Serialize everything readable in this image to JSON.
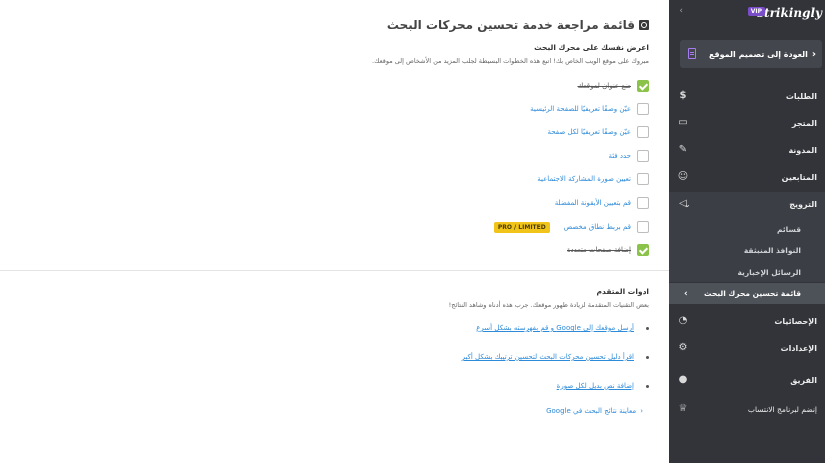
{
  "sidebar": {
    "logo": "strikingly",
    "vip_badge": "VIP",
    "back_button": "العودة إلى تصميم الموقع",
    "items": [
      {
        "label": "الطلبات",
        "icon": "dollar-icon"
      },
      {
        "label": "المتجر",
        "icon": "store-icon"
      },
      {
        "label": "المدونة",
        "icon": "pen-icon"
      },
      {
        "label": "المتابعين",
        "icon": "users-icon"
      },
      {
        "label": "الترويج",
        "icon": "megaphone-icon"
      },
      {
        "label": "الإحصائيات",
        "icon": "pie-chart-icon"
      },
      {
        "label": "الإعدادات",
        "icon": "gear-icon"
      },
      {
        "label": "الفريق",
        "icon": "team-icon"
      },
      {
        "label": "إنضم لبرنامج الانتساب",
        "icon": "trophy-icon"
      }
    ],
    "promotion_sub": [
      "قسائم",
      "النوافذ المنبثقة",
      "الرسائل الإخبارية",
      "قائمة تحسين محرك البحث"
    ]
  },
  "main": {
    "title": "قائمة مراجعة خدمة تحسين محركات البحث",
    "section_heading": "اعرض نفسك على محرك البحث",
    "section_desc": "مبروك على موقع الويب الخاص بك! اتبع هذه الخطوات البسيطة لجلب المزيد من الأشخاص إلى موقعك.",
    "tasks": [
      {
        "label": "ضع عنوان لموقعك",
        "done": true
      },
      {
        "label": "عيّن وصفًا تعريفيًا للصفحة الرئيسية",
        "done": false
      },
      {
        "label": "عيّن وصفًا تعريفيًا لكل صفحة",
        "done": false
      },
      {
        "label": "حدد فئة",
        "done": false
      },
      {
        "label": "تعيين صورة المشاركة الاجتماعية",
        "done": false
      },
      {
        "label": "قم بتعيين الأيقونة المفضلة",
        "done": false
      },
      {
        "label": "قم بربط نطاق مخصص",
        "done": false,
        "badge": "PRO / LIMITED"
      },
      {
        "label": "إضافة صفحات متعددة",
        "done": true
      }
    ],
    "advanced_heading": "ادوات المتقدم",
    "advanced_desc": "بعض التقنيات المتقدمة لزيادة ظهور موقعك. جرب هذه أدناه وشاهد النتائج!",
    "advanced_links": [
      "أرسل موقعك إلى Google و قم بفهرسته بشكل أسرع",
      "اقرأ دليل تحسين محركات البحث لتحسين ترتيبك بشكل أكبر",
      "إضافة نص بديل لكل صورة"
    ],
    "preview_link": "معاينة نتائج البحث في Google"
  }
}
